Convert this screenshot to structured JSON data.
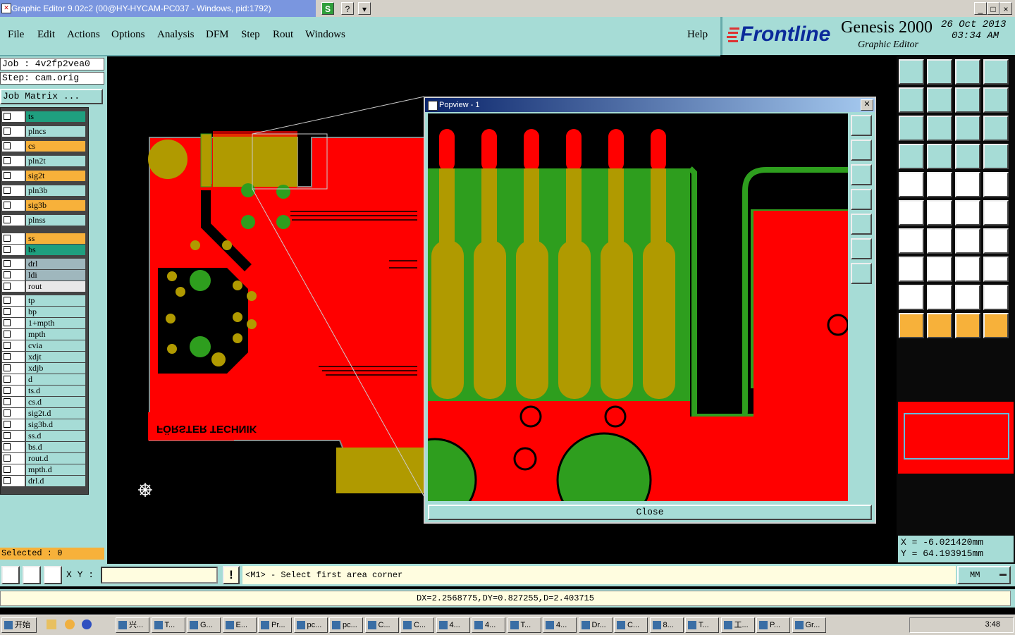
{
  "window": {
    "title": "Graphic Editor 9.02c2 (00@HY-HYCAM-PC037 - Windows, pid:1792)",
    "title_buttons": [
      "S",
      "?",
      "▾"
    ],
    "controls": [
      "_",
      "□",
      "×"
    ]
  },
  "menu": {
    "items": [
      "File",
      "Edit",
      "Actions",
      "Options",
      "Analysis",
      "DFM",
      "Step",
      "Rout",
      "Windows"
    ],
    "help": "Help"
  },
  "brand": {
    "logo": "Frontline",
    "product": "Genesis 2000",
    "subtitle": "Graphic Editor",
    "date": "26 Oct 2013",
    "time": "03:34 AM"
  },
  "job": {
    "job": "Job  : 4v2fp2vea0",
    "step": "Step: cam.orig",
    "matrix_button": "Job Matrix ..."
  },
  "layers": [
    {
      "name": "ts",
      "color": "#1f9f7f"
    },
    {
      "name": "plncs",
      "color": "#a6dcd6"
    },
    {
      "name": "cs",
      "color": "#f7b13a"
    },
    {
      "name": "pln2t",
      "color": "#a6dcd6"
    },
    {
      "name": "sig2t",
      "color": "#f7b13a"
    },
    {
      "name": "pln3b",
      "color": "#a6dcd6"
    },
    {
      "name": "sig3b",
      "color": "#f7b13a"
    },
    {
      "name": "plnss",
      "color": "#a6dcd6"
    },
    {
      "name": "ss",
      "color": "#f7b13a"
    },
    {
      "name": "bs",
      "color": "#1f9f7f"
    },
    {
      "name": "drl",
      "color": "#9fb7bd"
    },
    {
      "name": "ldi",
      "color": "#9fb7bd"
    },
    {
      "name": "rout",
      "color": "#e8e8e8"
    },
    {
      "name": "tp",
      "color": "#a6dcd6"
    },
    {
      "name": "bp",
      "color": "#a6dcd6"
    },
    {
      "name": "1+mpth",
      "color": "#a6dcd6"
    },
    {
      "name": "mpth",
      "color": "#a6dcd6"
    },
    {
      "name": "cvia",
      "color": "#a6dcd6"
    },
    {
      "name": "xdjt",
      "color": "#a6dcd6"
    },
    {
      "name": "xdjb",
      "color": "#a6dcd6"
    },
    {
      "name": "d",
      "color": "#a6dcd6"
    },
    {
      "name": "ts.d",
      "color": "#a6dcd6"
    },
    {
      "name": "cs.d",
      "color": "#a6dcd6"
    },
    {
      "name": "sig2t.d",
      "color": "#a6dcd6"
    },
    {
      "name": "sig3b.d",
      "color": "#a6dcd6"
    },
    {
      "name": "ss.d",
      "color": "#a6dcd6"
    },
    {
      "name": "bs.d",
      "color": "#a6dcd6"
    },
    {
      "name": "rout.d",
      "color": "#a6dcd6"
    },
    {
      "name": "mpth.d",
      "color": "#a6dcd6"
    },
    {
      "name": "drl.d",
      "color": "#a6dcd6"
    }
  ],
  "selected": "Selected : 0",
  "pcb": {
    "logo_text": "FÖRSTER TECHNIK"
  },
  "popview": {
    "title": "Popview - 1",
    "close": "Close"
  },
  "coords": {
    "x": "X  =  -6.021420mm",
    "y": "Y  =  64.193915mm"
  },
  "command": {
    "xy_label": "X Y :",
    "xy_value": "",
    "prompt": "<M1> - Select first area corner",
    "units": "MM"
  },
  "measure": "DX=2.2568775,DY=0.827255,D=2.403715",
  "taskbar": {
    "start": "开始",
    "tasks": [
      "兴...",
      "T...",
      "G...",
      "E...",
      "Pr...",
      "pc...",
      "pc...",
      "C...",
      "C...",
      "4...",
      "4...",
      "T...",
      "4...",
      "Dr...",
      "C...",
      "8...",
      "T...",
      "工...",
      "P...",
      "Gr..."
    ],
    "clock": "3:48"
  },
  "colors": {
    "teal": "#a6dcd6",
    "red_copper": "#ff0000",
    "green_mask": "#2e9e1e",
    "olive": "#b09a00",
    "orange": "#f7b13a"
  }
}
